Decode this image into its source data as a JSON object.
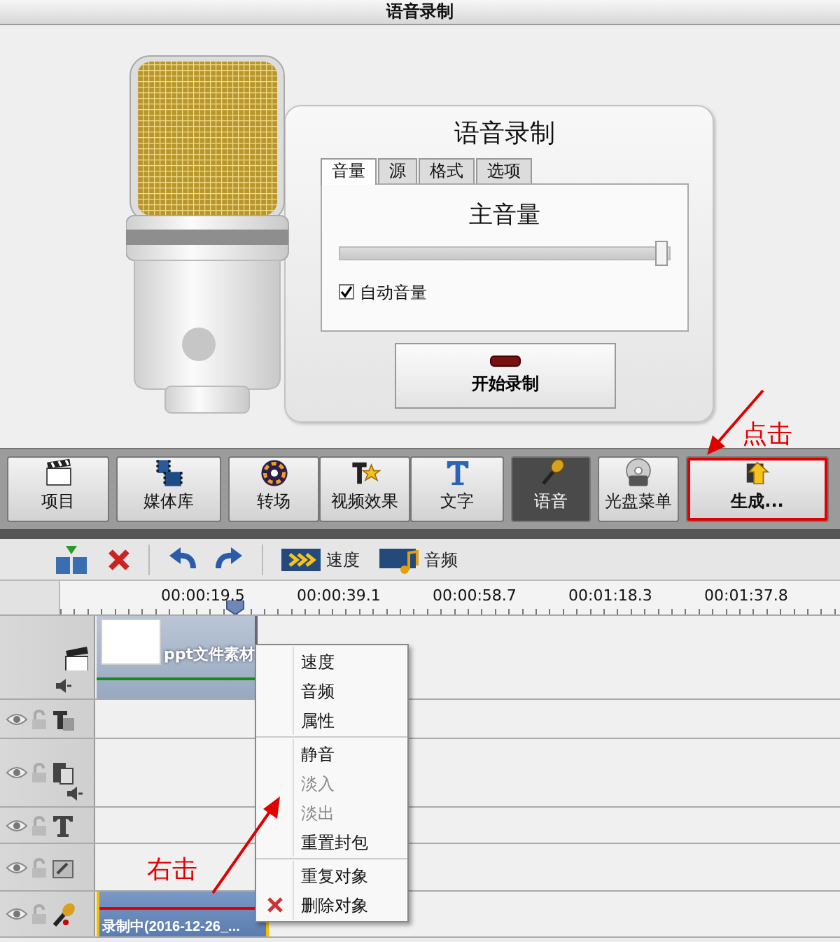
{
  "window": {
    "title": "语音录制"
  },
  "recorder": {
    "title": "语音录制",
    "tabs": [
      {
        "label": "音量",
        "selected": true
      },
      {
        "label": "源",
        "selected": false
      },
      {
        "label": "格式",
        "selected": false
      },
      {
        "label": "选项",
        "selected": false
      }
    ],
    "volume_heading": "主音量",
    "volume": {
      "level": 0.98
    },
    "auto_volume": {
      "label": "自动音量",
      "checked": true
    },
    "record_button": "开始录制"
  },
  "main_toolbar": [
    {
      "label": "项目",
      "selected": false,
      "framed": false
    },
    {
      "label": "媒体库",
      "selected": false,
      "framed": false
    },
    {
      "label": "转场",
      "selected": false,
      "framed": false
    },
    {
      "label": "视频效果",
      "selected": false,
      "framed": false
    },
    {
      "label": "文字",
      "selected": false,
      "framed": false
    },
    {
      "label": "语音",
      "selected": true,
      "framed": false
    },
    {
      "label": "光盘菜单",
      "selected": false,
      "framed": false
    },
    {
      "label": "生成...",
      "selected": false,
      "framed": true
    }
  ],
  "timeline_toolbar": [
    {
      "label": "速度"
    },
    {
      "label": "音频"
    }
  ],
  "ruler": [
    "00:00:19.5",
    "00:00:39.1",
    "00:00:58.7",
    "00:01:18.3",
    "00:01:37.8"
  ],
  "tracks": [
    {
      "kind": "video",
      "clip": "ppt文件素材"
    },
    {
      "kind": "effect"
    },
    {
      "kind": "overlay"
    },
    {
      "kind": "text"
    },
    {
      "kind": "audio"
    },
    {
      "kind": "voice",
      "clip": "录制中(2016-12-26_..."
    }
  ],
  "context_menu": [
    [
      {
        "label": "速度",
        "disabled": false
      },
      {
        "label": "音频",
        "disabled": false
      },
      {
        "label": "属性",
        "disabled": false
      }
    ],
    [
      {
        "label": "静音",
        "disabled": false
      },
      {
        "label": "淡入",
        "disabled": true
      },
      {
        "label": "淡出",
        "disabled": true
      },
      {
        "label": "重置封包",
        "disabled": false
      }
    ],
    [
      {
        "label": "重复对象",
        "disabled": false
      },
      {
        "label": "删除对象",
        "disabled": false,
        "kind": "delete"
      }
    ]
  ],
  "annotations": [
    {
      "text": "点击"
    },
    {
      "text": "右击"
    }
  ]
}
